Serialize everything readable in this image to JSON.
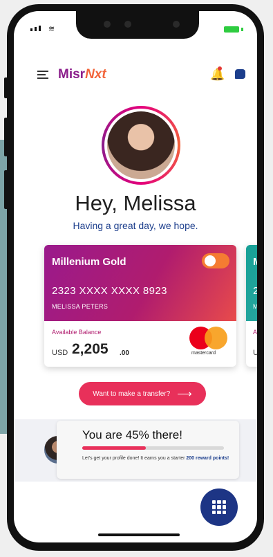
{
  "header": {
    "brand_part1": "Misr",
    "brand_part2": "Nxt"
  },
  "greeting": {
    "title": "Hey, Melissa",
    "subtitle": "Having a great day, we hope."
  },
  "card": {
    "name": "Millenium Gold",
    "number": "2323 XXXX XXXX 8923",
    "holder": "MELISSA PETERS",
    "balance_label": "Available Balance",
    "currency": "USD",
    "amount": "2,205",
    "decimals": ".00",
    "network": "mastercard",
    "toggle_on": true
  },
  "next_card": {
    "name_partial": "M",
    "number_partial": "2",
    "holder_partial": "M",
    "balance_label_partial": "A",
    "currency_partial": "US"
  },
  "transfer_button": {
    "label": "Want to make a transfer?",
    "icon": "arrow-right-icon"
  },
  "profile_progress": {
    "title": "You are 45% there!",
    "percent": 45,
    "text_prefix": "Let's get your profile done! It earns you a starter ",
    "text_bold": "200 reward points!"
  },
  "icons": {
    "menu": "menu-icon",
    "notifications": "bell-icon",
    "chat": "chat-icon",
    "apps": "grid-icon"
  },
  "colors": {
    "brand_purple": "#8b1d8b",
    "brand_orange": "#f2643a",
    "accent_pink": "#e8305a",
    "navy": "#1d3585"
  }
}
